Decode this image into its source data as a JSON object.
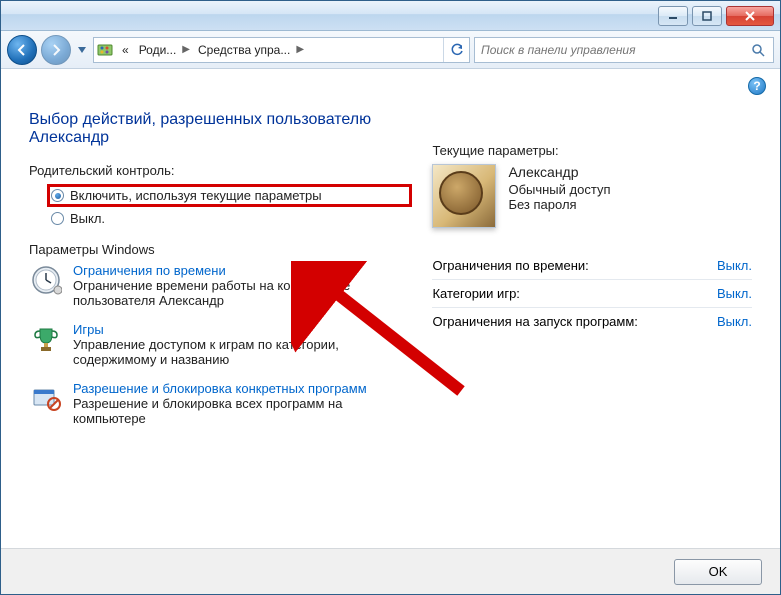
{
  "breadcrumb": {
    "prefix": "«",
    "seg1": "Роди...",
    "seg2": "Средства упра..."
  },
  "search": {
    "placeholder": "Поиск в панели управления"
  },
  "page_title": "Выбор действий, разрешенных пользователю Александр",
  "left": {
    "pc_label": "Родительский контроль:",
    "radio_on": "Включить, используя текущие параметры",
    "radio_off": "Выкл.",
    "win_params_label": "Параметры Windows",
    "time": {
      "link": "Ограничения по времени",
      "desc": "Ограничение времени работы на компьютере пользователя Александр"
    },
    "games": {
      "link": "Игры",
      "desc": "Управление доступом к играм по категории, содержимому и названию"
    },
    "progs": {
      "link": "Разрешение и блокировка конкретных программ",
      "desc": "Разрешение и блокировка всех программ на компьютере"
    }
  },
  "right": {
    "current_label": "Текущие параметры:",
    "user": {
      "name": "Александр",
      "role": "Обычный доступ",
      "pw": "Без пароля"
    },
    "rows": {
      "time_label": "Ограничения по времени:",
      "time_val": "Выкл.",
      "games_label": "Категории игр:",
      "games_val": "Выкл.",
      "progs_label": "Ограничения на запуск программ:",
      "progs_val": "Выкл."
    }
  },
  "footer": {
    "ok": "OK"
  }
}
